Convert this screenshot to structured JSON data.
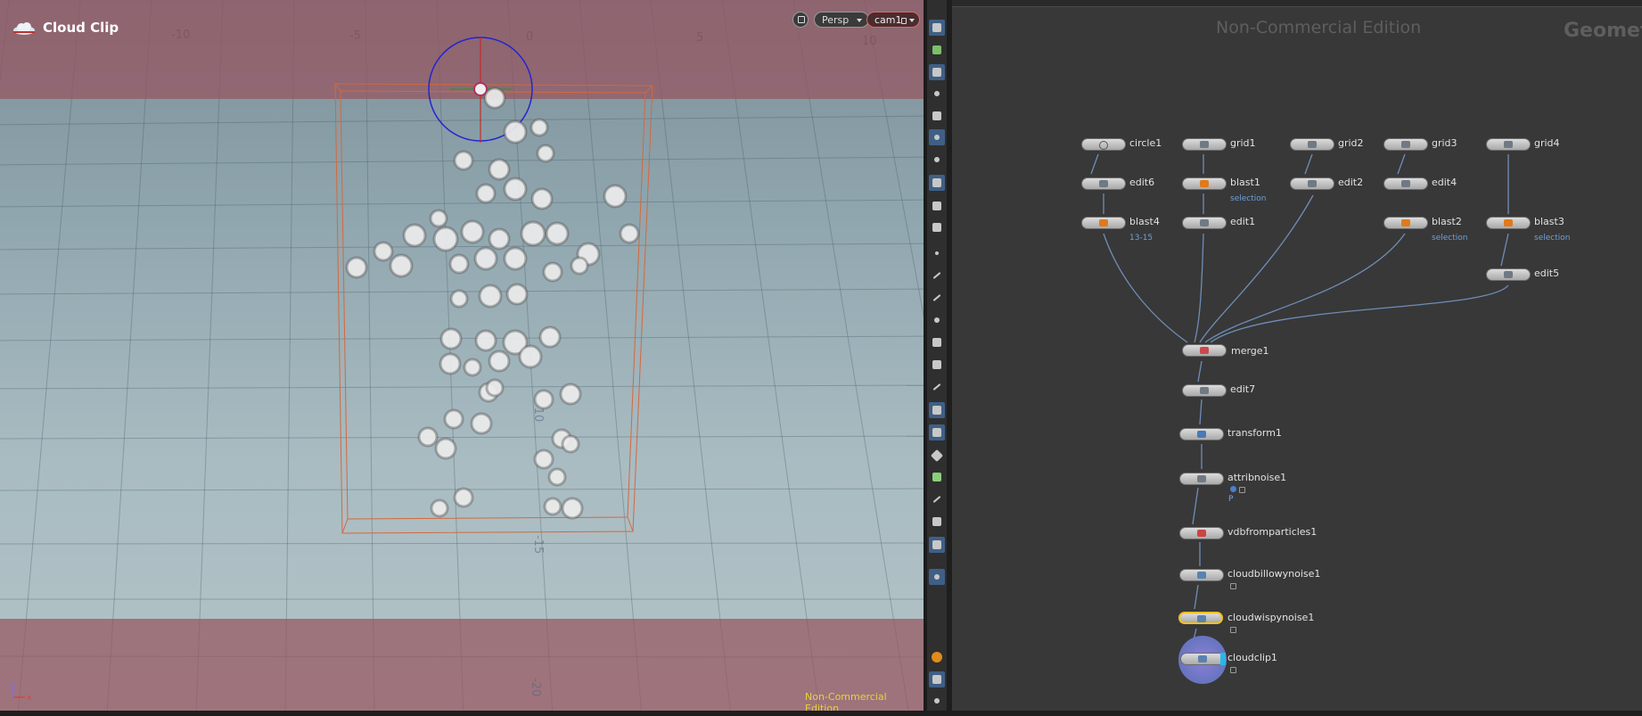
{
  "viewport": {
    "title": "Cloud Clip",
    "view_mode": "Persp",
    "camera": "cam1",
    "watermark": "Non-Commercial Edition",
    "ruler_labels": [
      "-10",
      "-5",
      "0",
      "5",
      "10"
    ],
    "depth_labels": [
      "-10",
      "-15",
      "-20"
    ],
    "axes": {
      "x": "x",
      "z": "z"
    }
  },
  "toolbar": {
    "icons": [
      "view-tool-icon",
      "select-tool-icon",
      "lock-icon",
      "snap-icon",
      "handle-icon",
      "pose-icon",
      "light-icon",
      "camera-icon",
      "render-icon",
      "brush-icon",
      "dot-icon",
      "edge-icon",
      "pen-icon",
      "number-icon",
      "bucket-icon",
      "counter-icon",
      "corner-icon",
      "magnet-icon",
      "uv-icon",
      "diamond-icon",
      "image-icon",
      "measure-icon",
      "square-icon",
      "screen-icon",
      "pin-icon",
      "warning-icon",
      "grid-icon",
      "eye-icon"
    ]
  },
  "network": {
    "watermark": "Non-Commercial Edition",
    "context_label": "Geomet",
    "nodes": [
      {
        "id": "circle1",
        "label": "circle1"
      },
      {
        "id": "grid1",
        "label": "grid1"
      },
      {
        "id": "grid2",
        "label": "grid2"
      },
      {
        "id": "grid3",
        "label": "grid3"
      },
      {
        "id": "grid4",
        "label": "grid4"
      },
      {
        "id": "edit6",
        "label": "edit6"
      },
      {
        "id": "blast1",
        "label": "blast1",
        "sub": "selection"
      },
      {
        "id": "edit2",
        "label": "edit2"
      },
      {
        "id": "edit4",
        "label": "edit4"
      },
      {
        "id": "blast4",
        "label": "blast4",
        "sub": "13-15"
      },
      {
        "id": "edit1",
        "label": "edit1"
      },
      {
        "id": "blast2",
        "label": "blast2",
        "sub": "selection"
      },
      {
        "id": "blast3",
        "label": "blast3",
        "sub": "selection"
      },
      {
        "id": "edit5",
        "label": "edit5"
      },
      {
        "id": "merge1",
        "label": "merge1"
      },
      {
        "id": "edit7",
        "label": "edit7"
      },
      {
        "id": "transform1",
        "label": "transform1"
      },
      {
        "id": "attribnoise1",
        "label": "attribnoise1",
        "sub": "P"
      },
      {
        "id": "vdbfromparticles1",
        "label": "vdbfromparticles1"
      },
      {
        "id": "cloudbillowynoise1",
        "label": "cloudbillowynoise1"
      },
      {
        "id": "cloudwispynoise1",
        "label": "cloudwispynoise1",
        "selected": true
      },
      {
        "id": "cloudclip1",
        "label": "cloudclip1"
      }
    ]
  }
}
